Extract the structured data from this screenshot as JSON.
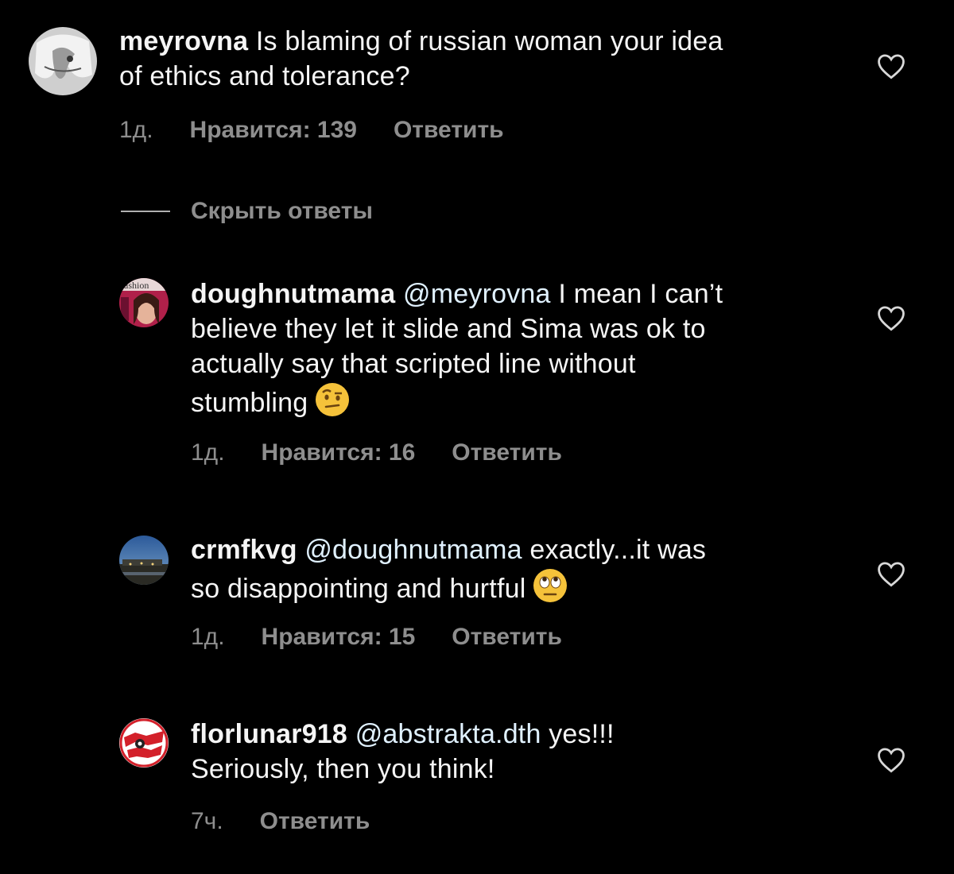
{
  "hide_replies_label": "Скрыть ответы",
  "comments": [
    {
      "username": "meyrovna",
      "mention": "",
      "text_line1": "Is blaming of russian woman your idea",
      "text_line2": "of ethics and tolerance?",
      "time": "1д.",
      "likes": "Нравится: 139",
      "reply": "Ответить"
    },
    {
      "username": "doughnutmama",
      "mention": "@meyrovna",
      "text_line1": "I mean I can’t",
      "text_line2": "believe they let it slide and Sima was ok to",
      "text_line3": "actually say that scripted line without",
      "text_line4": "stumbling",
      "emoji": "raised-eyebrow-emoji",
      "time": "1д.",
      "likes": "Нравится: 16",
      "reply": "Ответить"
    },
    {
      "username": "crmfkvg",
      "mention": "@doughnutmama",
      "text_line1": "exactly...it was",
      "text_line2": "so disappointing and hurtful",
      "emoji": "eye-roll-emoji",
      "time": "1д.",
      "likes": "Нравится: 15",
      "reply": "Ответить"
    },
    {
      "username": "florlunar918",
      "mention": "@abstrakta.dth",
      "text_line1": "yes!!!",
      "text_line2": "Seriously, then you think!",
      "time": "7ч.",
      "reply": "Ответить"
    }
  ],
  "colors": {
    "background": "#000000",
    "text": "#f5f5f5",
    "mention": "#e0f1ff",
    "meta": "#8e8e8e"
  }
}
